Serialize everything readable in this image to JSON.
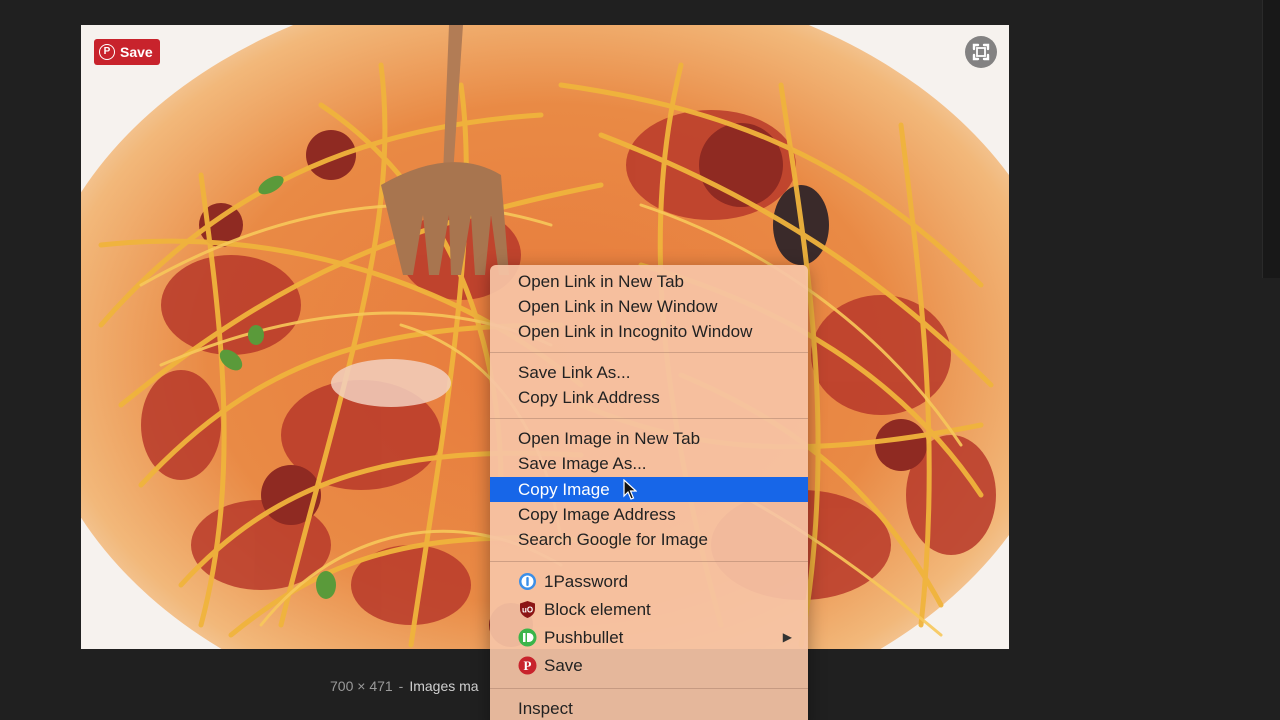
{
  "pin_button": {
    "label": "Save"
  },
  "caption": {
    "dimensions": "700 × 471",
    "separator": "-",
    "link_text": "Images ma"
  },
  "context_menu": {
    "groups": [
      [
        "Open Link in New Tab",
        "Open Link in New Window",
        "Open Link in Incognito Window"
      ],
      [
        "Save Link As...",
        "Copy Link Address"
      ],
      [
        "Open Image in New Tab",
        "Save Image As...",
        "Copy Image",
        "Copy Image Address",
        "Search Google for Image"
      ]
    ],
    "highlighted_item": "Copy Image",
    "extensions": [
      {
        "label": "1Password",
        "icon": "1password-icon",
        "color": "#3b8fe8"
      },
      {
        "label": "Block element",
        "icon": "ublock-icon",
        "color": "#8c1515"
      },
      {
        "label": "Pushbullet",
        "icon": "pushbullet-icon",
        "color": "#3bb54a",
        "has_submenu": true
      },
      {
        "label": "Save",
        "icon": "pinterest-icon",
        "color": "#c8232c"
      }
    ],
    "inspect_label": "Inspect"
  },
  "colors": {
    "highlight": "#1766e8",
    "menu_background": "#f6c4a6",
    "pinterest_red": "#c8232c"
  }
}
